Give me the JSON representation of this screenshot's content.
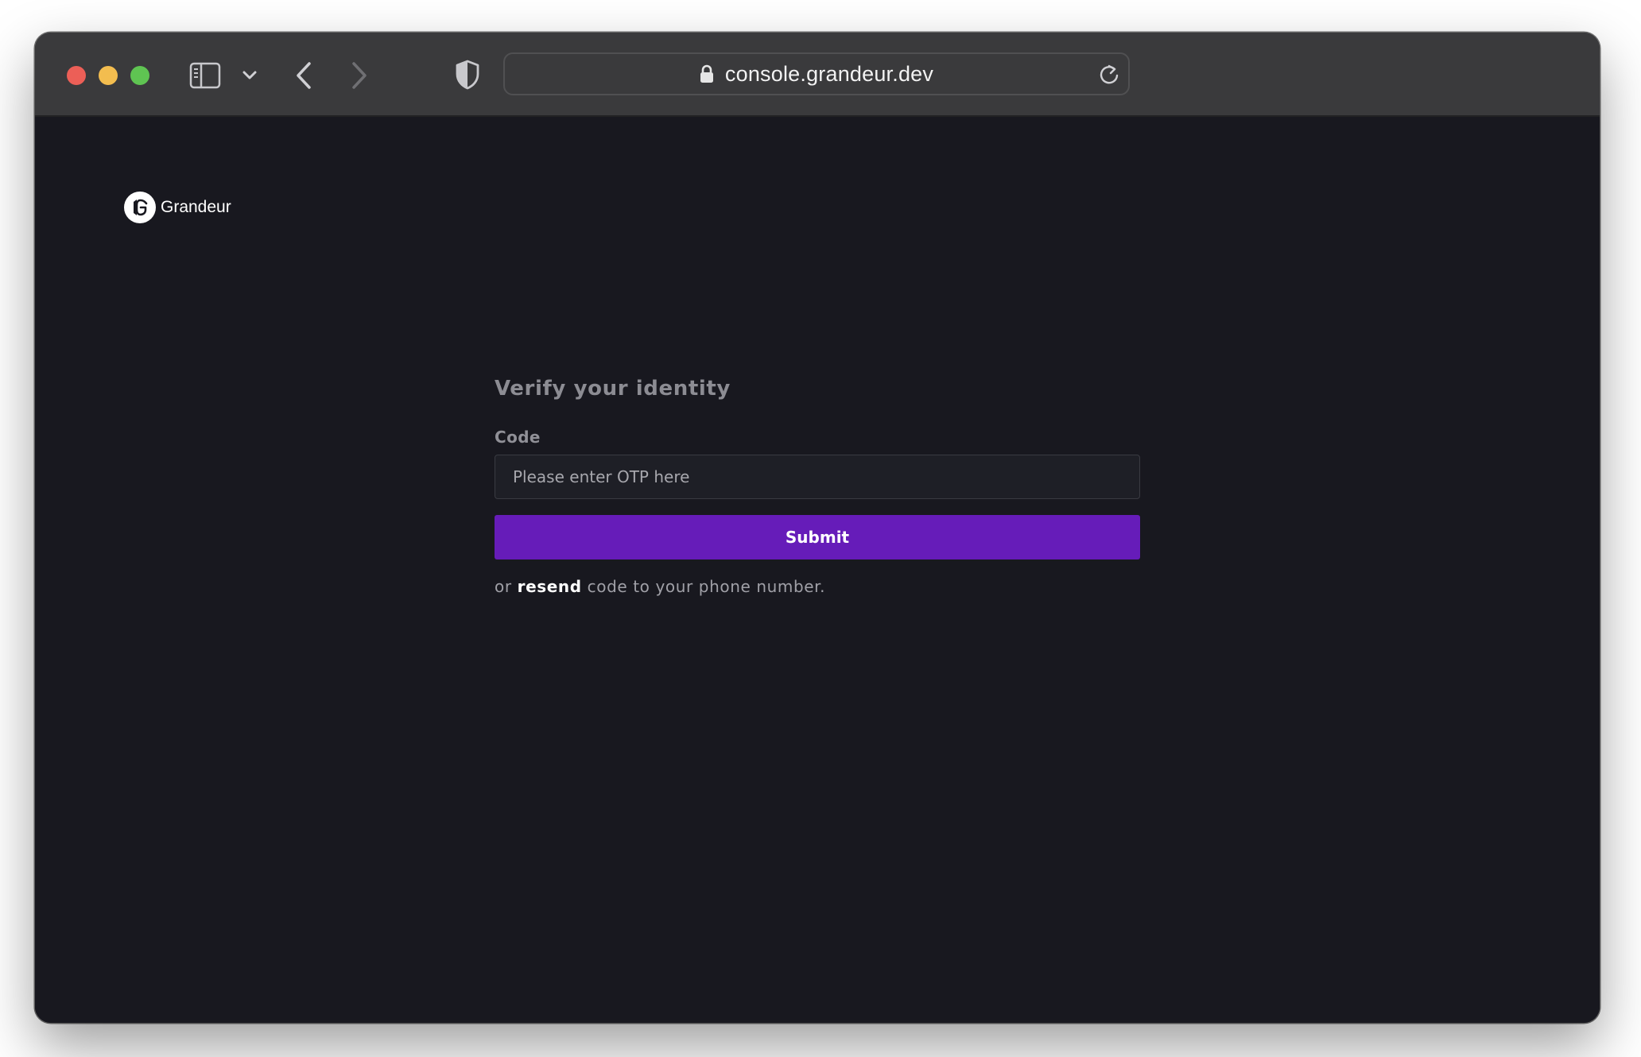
{
  "browser": {
    "url": "console.grandeur.dev",
    "traffic_lights": {
      "close_color": "#ec5f57",
      "minimize_color": "#f3bd4f",
      "maximize_color": "#5fc452"
    },
    "toolbar_icons": [
      "sidebar-icon",
      "chevron-down-icon",
      "back-icon",
      "forward-icon",
      "shield-icon",
      "lock-icon",
      "reload-icon"
    ]
  },
  "brand": {
    "name": "Grandeur",
    "logo_icon": "grandeur-logo-icon"
  },
  "verify": {
    "title": "Verify your identity",
    "code_label": "Code",
    "code_value": "",
    "code_placeholder": "Please enter OTP here",
    "submit_label": "Submit",
    "resend_prefix": "or ",
    "resend_link": "resend",
    "resend_suffix": " code to your phone number."
  },
  "colors": {
    "background": "#18181f",
    "accent": "#661cb9",
    "title_text": "#8c8c93",
    "link_text": "#ffffff"
  }
}
